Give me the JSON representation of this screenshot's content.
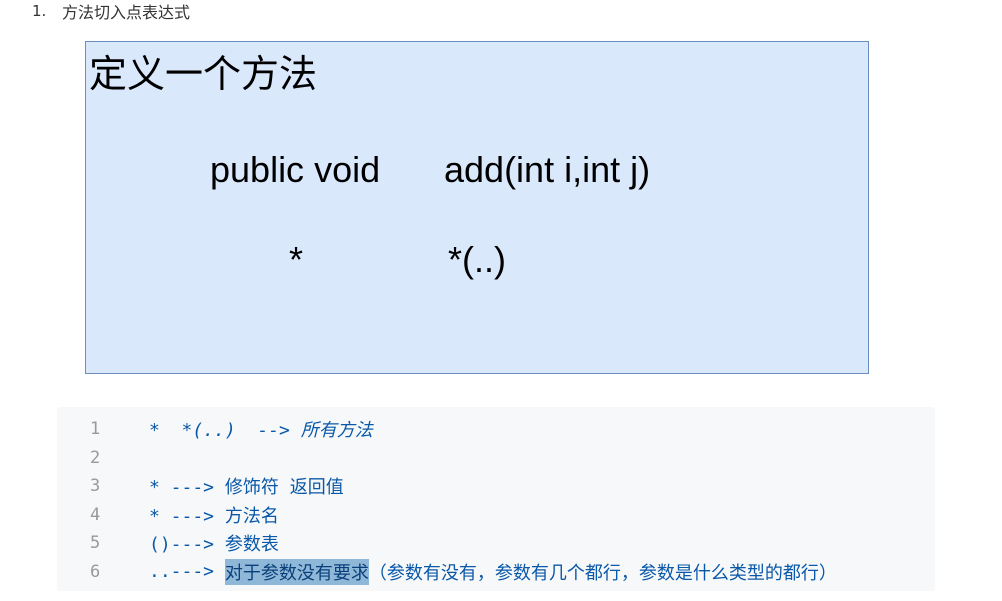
{
  "list": {
    "number": "1.",
    "text": "方法切入点表达式"
  },
  "figure": {
    "title": "定义一个方法",
    "line1_left": "public void",
    "line1_right": "add(int i,int j)",
    "line2_left": "*",
    "line2_right": "*(..)"
  },
  "code": {
    "lines": [
      {
        "num": "1",
        "text": "*  *(..)  --> 所有方法"
      },
      {
        "num": "2",
        "text": ""
      },
      {
        "num": "3",
        "text": "* ---> 修饰符 返回值"
      },
      {
        "num": "4",
        "text": "* ---> 方法名"
      },
      {
        "num": "5",
        "text": "()---> 参数表"
      },
      {
        "num": "6",
        "prefix": "..---> ",
        "highlight": "对于参数没有要求",
        "rest": "（参数有没有，参数有几个都行，参数是什么类型的都行）"
      }
    ]
  },
  "colors": {
    "figure_fill": "#dae8fc",
    "figure_border": "#6c8ebf",
    "code_bg": "#f6f8fa",
    "code_text": "#0a58a8",
    "selection_highlight": "#8fb8d8"
  }
}
